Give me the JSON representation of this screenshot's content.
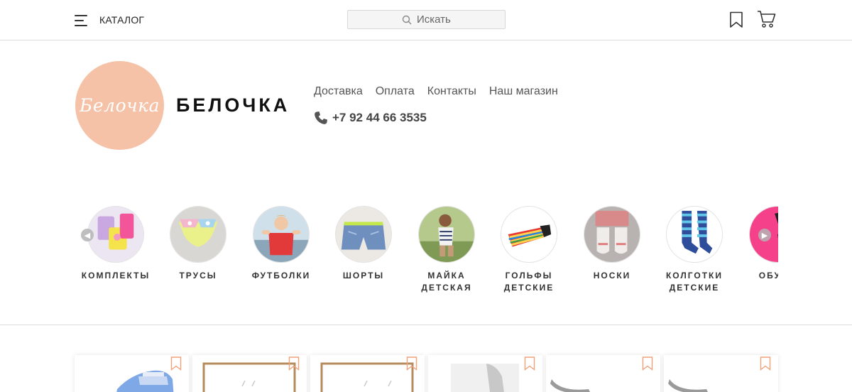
{
  "topbar": {
    "catalog_label": "КАТАЛОГ",
    "search_placeholder": "Искать",
    "icons": [
      "menu-icon",
      "search-icon",
      "bookmark-icon",
      "cart-icon"
    ]
  },
  "header": {
    "logo_text": "Белочка",
    "shop_name": "БЕЛОЧКА",
    "nav": [
      "Доставка",
      "Оплата",
      "Контакты",
      "Наш магазин"
    ],
    "phone": "+7 92 44 66 3535",
    "logo_color": "#f5c2a7"
  },
  "categories": [
    {
      "label": "КОМПЛЕКТЫ"
    },
    {
      "label": "ТРУСЫ"
    },
    {
      "label": "ФУТБОЛКИ"
    },
    {
      "label": "ШОРТЫ"
    },
    {
      "label": "МАЙКА ДЕТСКАЯ"
    },
    {
      "label": "ГОЛЬФЫ ДЕТСКИЕ"
    },
    {
      "label": "НОСКИ"
    },
    {
      "label": "КОЛГОТКИ ДЕТСКИЕ"
    },
    {
      "label": "ОБУВЬ"
    }
  ],
  "accent_color": "#f0a27a"
}
